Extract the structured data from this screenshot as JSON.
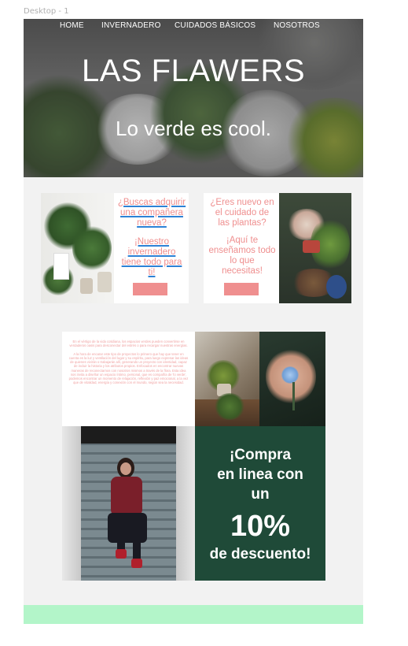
{
  "frame_label": "Desktop - 1",
  "nav": [
    "HOME",
    "INVERNADERO",
    "CUIDADOS BÁSICOS",
    "NOSOTROS"
  ],
  "hero": {
    "title": "LAS FLAWERS",
    "tagline": "Lo verde es cool."
  },
  "card_left": {
    "text_1": "¿Buscas adquirir una compañera nueva?",
    "text_2": "¡Nuestro invernadero tiene todo para ti!"
  },
  "card_right": {
    "text_1": "¿Eres nuevo en el cuidado de las plantas?",
    "text_2": "¡Aquí te enseñamos todo lo que necesitas!"
  },
  "story": {
    "p1": "En el vértigo de la vida cotidiana, los espacios verdes pueden convertirse en verdaderos oasis para desconectar del estrés o para recargar nuestras energías.",
    "p2": "A la hora de encarar este tipo de proyectos lo primero que hay que tener en cuenta es la luz y ventilación del lugar y su espíritu, para luego expresar las ideas de quienes vivirán o trabajarán allí, generando un proyecto con identidad, capaz de incluir la historia y los atributos propios. Enfocados en encontrar nuevas maneras de reconectarnos con nosotros mismos a través de la flora. Esta idea nos invita a diseñar un espacio íntimo, personal, que es compañía de 'lo verde', podemos encontrar un momento de relajación, reflexión y paz emocional, a la vez que de vitalidad, energía y conexión con el mundo, según sea la necesidad."
  },
  "promo": {
    "line1": "¡Compra",
    "line2": "en linea con",
    "line3": "un",
    "big": "10%",
    "line5": "de descuento!"
  },
  "colors": {
    "accent_pink": "#ef8f8f",
    "promo_green": "#1f4a38",
    "footer_mint": "#b3f5c9",
    "link_blue": "#2d82d6"
  }
}
